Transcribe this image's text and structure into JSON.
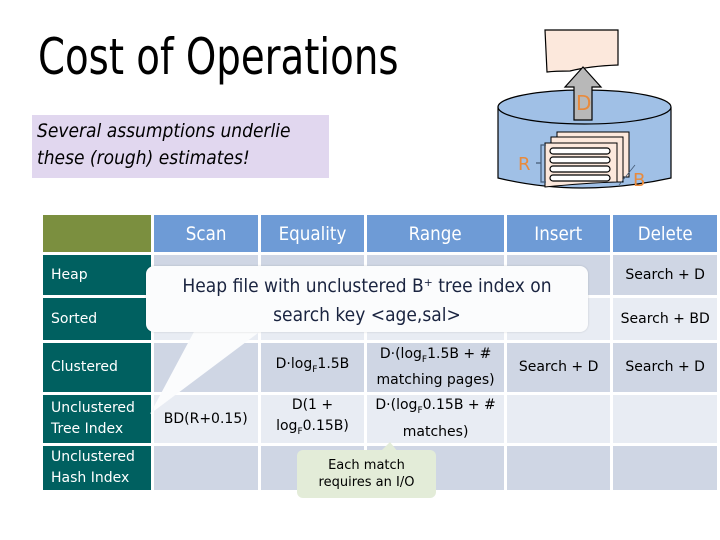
{
  "slide": {
    "title": "Cost of Operations",
    "note_lines": [
      "Several assumptions underlie",
      "these (rough) estimates!"
    ]
  },
  "diagram": {
    "labels": {
      "d": "D",
      "r": "R",
      "b": "B"
    },
    "colors": {
      "disk": "#a0c0e6",
      "page": "#fce8dc",
      "arrow": "#b8b8b8",
      "label": "#e88a3c"
    }
  },
  "table": {
    "headers": [
      "",
      "Scan",
      "Equality",
      "Range",
      "Insert",
      "Delete"
    ],
    "rows": [
      {
        "label": [
          "Heap"
        ],
        "cells": [
          "",
          "",
          "",
          "",
          "Search + D"
        ]
      },
      {
        "label": [
          "Sorted"
        ],
        "cells": [
          "",
          "",
          "",
          "",
          "Search + BD"
        ]
      },
      {
        "label": [
          "Clustered"
        ],
        "cells": [
          "",
          "D·log_F1.5B",
          "D·(log_F1.5B + # matching pages)",
          "Search + D",
          "Search + D"
        ]
      },
      {
        "label": [
          "Unclustered",
          "Tree Index"
        ],
        "cells": [
          "BD(R+0.15)",
          "D(1 + log_F0.15B)",
          "D·(log_F0.15B + # matches)",
          "",
          ""
        ]
      },
      {
        "label": [
          "Unclustered",
          "Hash Index"
        ],
        "cells": [
          "",
          "",
          "",
          "",
          ""
        ]
      }
    ],
    "display": {
      "clustered_equality_prefix": "D·log",
      "clustered_equality_suffix": "1.5B",
      "clustered_range_line1_prefix": "D·(log",
      "clustered_range_line1_suffix": "1.5B + #",
      "clustered_range_line2": "matching pages)",
      "unc_scan": "BD(R+0.15)",
      "unc_equality_line1": "D(1 +",
      "unc_equality_line2_prefix": "log",
      "unc_equality_line2_suffix": "0.15B)",
      "unc_range_line1_prefix": "D·(log",
      "unc_range_line1_suffix": "0.15B + #",
      "unc_range_line2": "matches)",
      "subscript": "F"
    }
  },
  "callouts": {
    "main_lines": [
      "Heap file with unclustered B⁺ tree index on",
      "search key <age,sal>"
    ],
    "secondary_lines": [
      "Each match",
      "requires an I/O"
    ]
  }
}
